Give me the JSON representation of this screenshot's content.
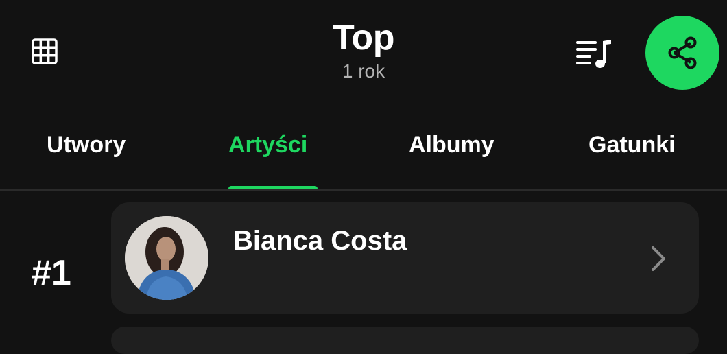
{
  "header": {
    "title": "Top",
    "subtitle": "1 rok",
    "grid_icon": "grid-icon",
    "queue_icon": "music-queue-icon",
    "share_icon": "share-icon"
  },
  "colors": {
    "background": "#121212",
    "accent": "#1ed760",
    "card": "#1f1f1f",
    "muted_text": "#b3b3b3"
  },
  "tabs": [
    {
      "label": "Utwory",
      "active": false
    },
    {
      "label": "Artyści",
      "active": true
    },
    {
      "label": "Albumy",
      "active": false
    },
    {
      "label": "Gatunki",
      "active": false
    }
  ],
  "list": [
    {
      "rank": "#1",
      "name": "Bianca Costa",
      "icon": "chevron-right-icon"
    }
  ]
}
